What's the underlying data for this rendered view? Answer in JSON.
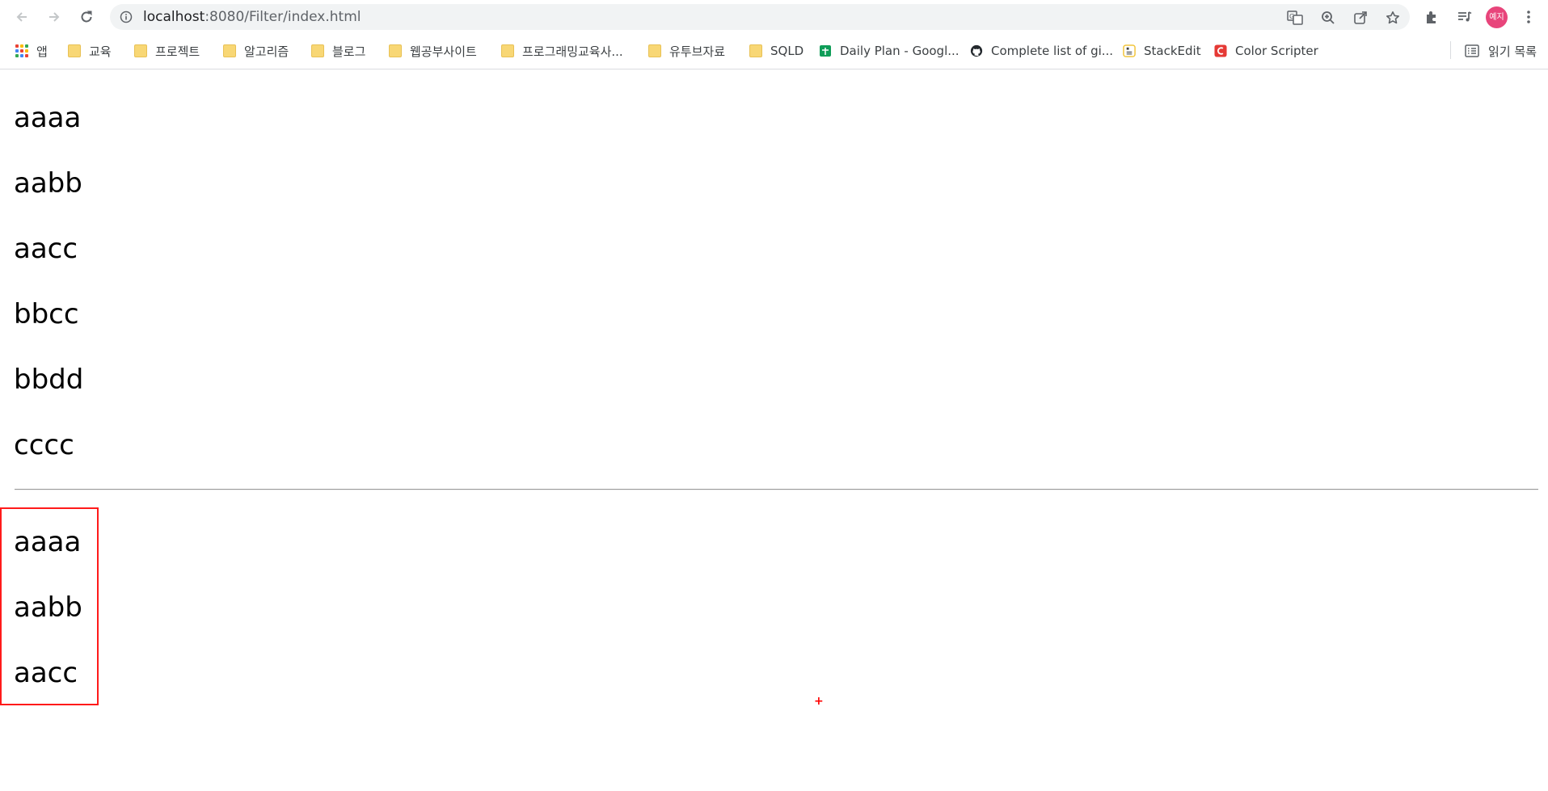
{
  "browser": {
    "url_host": "localhost",
    "url_rest": ":8080/Filter/index.html",
    "profile_initials": "예지"
  },
  "bookmarks": {
    "apps_label": "앱",
    "items": [
      {
        "label": "교육",
        "icon": "folder-icon"
      },
      {
        "label": "프로젝트",
        "icon": "folder-icon"
      },
      {
        "label": "알고리즘",
        "icon": "folder-icon"
      },
      {
        "label": "블로그",
        "icon": "folder-icon"
      },
      {
        "label": "웹공부사이트",
        "icon": "folder-icon"
      },
      {
        "label": "프로그래밍교육사...",
        "icon": "folder-icon"
      },
      {
        "label": "유투브자료",
        "icon": "folder-icon"
      },
      {
        "label": "SQLD",
        "icon": "folder-icon"
      },
      {
        "label": "Daily Plan - Googl...",
        "icon": "sheets-icon"
      },
      {
        "label": "Complete list of gi...",
        "icon": "github-icon"
      },
      {
        "label": "StackEdit",
        "icon": "stackedit-icon"
      },
      {
        "label": "Color Scripter",
        "icon": "colorscripter-icon"
      }
    ],
    "reading_list_label": "읽기 목록"
  },
  "page": {
    "all_items": [
      "aaaa",
      "aabb",
      "aacc",
      "bbcc",
      "bbdd",
      "cccc"
    ],
    "filtered_items": [
      "aaaa",
      "aabb",
      "aacc"
    ],
    "highlight_color": "#ff1a1a",
    "cursor_glyph": "+"
  }
}
